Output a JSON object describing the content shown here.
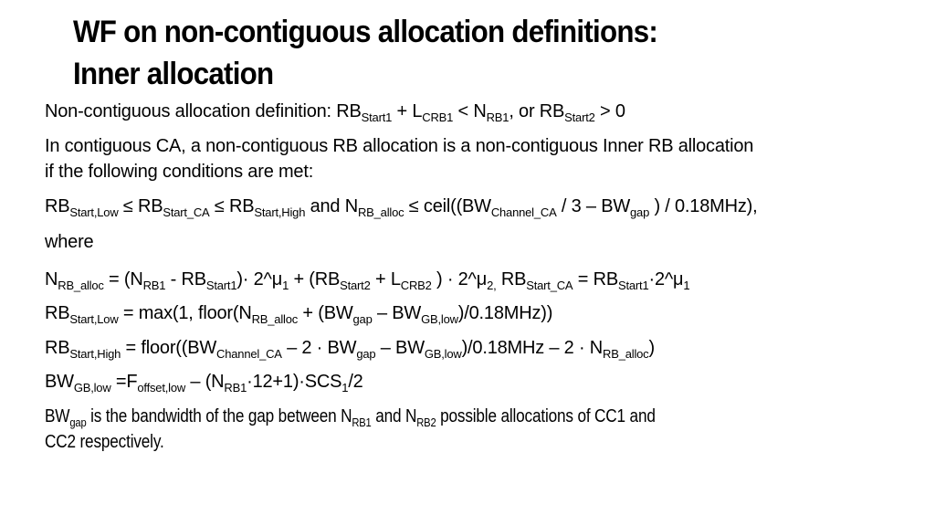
{
  "slide": {
    "title_lines": [
      "WF on non-contiguous allocation definitions:",
      "Inner allocation"
    ],
    "paragraphs": [
      {
        "id": "definition",
        "lines": [
          [
            {
              "t": "Non-contiguous allocation definition: RB"
            },
            {
              "t": "Start1",
              "sub": true
            },
            {
              "t": " + L"
            },
            {
              "t": "CRB1",
              "sub": true
            },
            {
              "t": " < N"
            },
            {
              "t": "RB1",
              "sub": true
            },
            {
              "t": ", or RB"
            },
            {
              "t": "Start2",
              "sub": true
            },
            {
              "t": " > 0"
            }
          ]
        ]
      },
      {
        "id": "contiguous-ca-intro",
        "lines": [
          [
            {
              "t": "In contiguous CA, a non-contiguous RB allocation is a non-contiguous Inner RB allocation"
            }
          ],
          [
            {
              "t": "if the following conditions are met:"
            }
          ]
        ]
      },
      {
        "id": "condition",
        "lines": [
          [
            {
              "t": "RB"
            },
            {
              "t": "Start,Low",
              "sub": true
            },
            {
              "t": "  ≤  RB"
            },
            {
              "t": "Start_CA",
              "sub": true
            },
            {
              "t": "  ≤  RB"
            },
            {
              "t": "Start,High",
              "sub": true
            },
            {
              "t": " and N"
            },
            {
              "t": "RB_alloc",
              "sub": true
            },
            {
              "t": " ≤  ceil((BW"
            },
            {
              "t": "Channel_CA",
              "sub": true
            },
            {
              "t": " / 3 – BW"
            },
            {
              "t": "gap",
              "sub": true
            },
            {
              "t": " ) / 0.18MHz),"
            }
          ],
          [
            {
              "t": "where"
            }
          ]
        ]
      },
      {
        "id": "n-rb-alloc",
        "lines": [
          [
            {
              "t": "N"
            },
            {
              "t": "RB_alloc",
              "sub": true
            },
            {
              "t": " = (N"
            },
            {
              "t": "RB1",
              "sub": true
            },
            {
              "t": " - RB"
            },
            {
              "t": "Start1",
              "sub": true
            },
            {
              "t": ")· 2^μ"
            },
            {
              "t": "1",
              "sub": true
            },
            {
              "t": " + (RB"
            },
            {
              "t": "Start2",
              "sub": true
            },
            {
              "t": " + L"
            },
            {
              "t": "CRB2",
              "sub": true
            },
            {
              "t": " ) · 2^μ"
            },
            {
              "t": "2,",
              "sub": true
            },
            {
              "t": " RB"
            },
            {
              "t": "Start_CA",
              "sub": true
            },
            {
              "t": " = RB"
            },
            {
              "t": "Start1",
              "sub": true
            },
            {
              "t": "·2^μ"
            },
            {
              "t": "1",
              "sub": true
            }
          ]
        ]
      },
      {
        "id": "rb-start-low",
        "lines": [
          [
            {
              "t": "RB"
            },
            {
              "t": "Start,Low",
              "sub": true
            },
            {
              "t": " = max(1, floor(N"
            },
            {
              "t": "RB_alloc",
              "sub": true
            },
            {
              "t": " + (BW"
            },
            {
              "t": "gap",
              "sub": true
            },
            {
              "t": " – BW"
            },
            {
              "t": "GB,low",
              "sub": true
            },
            {
              "t": ")/0.18MHz))"
            }
          ]
        ]
      },
      {
        "id": "rb-start-high",
        "lines": [
          [
            {
              "t": "RB"
            },
            {
              "t": "Start,High",
              "sub": true
            },
            {
              "t": " = floor((BW"
            },
            {
              "t": "Channel_CA",
              "sub": true
            },
            {
              "t": " – 2 · BW"
            },
            {
              "t": "gap",
              "sub": true
            },
            {
              "t": " – BW"
            },
            {
              "t": "GB,low",
              "sub": true
            },
            {
              "t": ")/0.18MHz – 2 · N"
            },
            {
              "t": "RB_alloc",
              "sub": true
            },
            {
              "t": ")"
            }
          ]
        ]
      },
      {
        "id": "bw-gb-low",
        "lines": [
          [
            {
              "t": "BW"
            },
            {
              "t": "GB,low",
              "sub": true
            },
            {
              "t": " =F"
            },
            {
              "t": "offset,low",
              "sub": true
            },
            {
              "t": " – (N"
            },
            {
              "t": "RB1",
              "sub": true
            },
            {
              "t": "·12+1)·SCS"
            },
            {
              "t": "1",
              "sub": true
            },
            {
              "t": "/2"
            }
          ]
        ]
      },
      {
        "id": "bw-gap-description",
        "lines": [
          [
            {
              "t": "BW"
            },
            {
              "t": "gap",
              "sub": true
            },
            {
              "t": " is the bandwidth of the gap between N"
            },
            {
              "t": "RB1",
              "sub": true
            },
            {
              "t": " and N"
            },
            {
              "t": "RB2",
              "sub": true
            },
            {
              "t": " possible allocations of CC1 and"
            }
          ],
          [
            {
              "t": "CC2 respectively."
            }
          ]
        ]
      }
    ]
  }
}
